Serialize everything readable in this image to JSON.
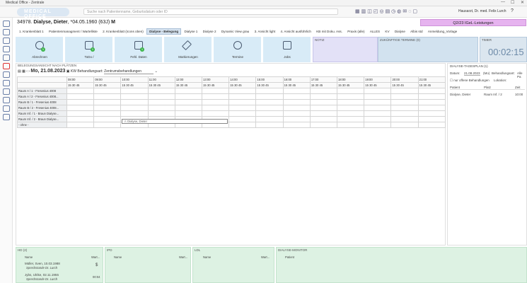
{
  "window": {
    "title": "Medical Office - Zentrale"
  },
  "header": {
    "logo": "MEDICAL OFFICE",
    "search_placeholder": "Suche nach Patientenname, Geburtsdatum oder ID",
    "user": "Hausarzt, Dr. med. Felix Lurch"
  },
  "patient": {
    "id": "34978.",
    "name": "Dialyse, Dieter",
    "dob": "*04.05.1960 (63J)",
    "sex": "M"
  },
  "igel_button": "Q2/23 IGeL-Leistungen",
  "tabs": [
    "1. Krankenblatt 1",
    "Patientenmanagment / Wartelliste",
    "2. Krankenblatt (Icons oben)",
    "Dialyse - Belegung",
    "Dialyse 1",
    "Dialyse 2",
    "Dynamic View grau",
    "3. Ansicht light",
    "4. Ansicht ausführlich",
    "KB mit Doku. Ass.",
    "Praxis (alle)",
    "ALLES",
    "KV",
    "Dialyse",
    "Albis std",
    "Anmeldung_Vorlage"
  ],
  "active_tab": "Dialyse - Belegung",
  "tiles": [
    {
      "label": "Abrechnen",
      "badge": "1"
    },
    {
      "label": "ToDo /",
      "badge": "1"
    },
    {
      "label": "Fehl. Daten",
      "badge": "1"
    },
    {
      "label": "Markierungen",
      "badge": ""
    },
    {
      "label": "Termine",
      "badge": ""
    },
    {
      "label": "Jobs",
      "badge": ""
    }
  ],
  "panels": {
    "notiz": "NOTIZ",
    "zukuenftige": "ZUKÜNFTIGE TERMINE (0)",
    "timer": "TIMER",
    "timer_value": "00:02:15"
  },
  "belegung": {
    "title": "BELEGUNGSANSICHT NACH PLÄTZEN",
    "date": "Mo, 21.08.2023",
    "kw": "KW",
    "behandlungsart_label": "Behandlungsart:",
    "behandlungsart_value": "Zentrumsbehandlungen",
    "hours": [
      "08:00",
      "09:00",
      "10:00",
      "11:00",
      "12:00",
      "13:00",
      "14:00",
      "15:00",
      "16:00",
      "17:00",
      "18:00",
      "19:00",
      "20:00",
      "21:00"
    ],
    "quarters": [
      "15",
      "30",
      "45"
    ],
    "rooms": [
      "Raum A / 1 - Fresenius 4008",
      "Raum A / 2 - Fresenius 4008...",
      "Raum B / 1 - Fresenius 4008",
      "Raum B / 2 - Fresenius 4008...",
      "Raum Inf. / 1 - Braun Dialyse...",
      "Raum Inf. / 2 - Braun Dialyse...",
      "- ohne -"
    ],
    "appointment": "Dialyse, Dieter"
  },
  "dialyse_tagesplan": {
    "title": "DIALYSE-TAGESPLAN (1)",
    "datum_label": "Datum:",
    "datum_value": "21.08.2023",
    "day": "(Mo)",
    "behandlungsart": "Behandlungsart:",
    "behandlungsart_value": "Alle Pa",
    "filter": "nur offene Behandlungen",
    "lokation": "Lokation:",
    "columns": [
      "Patient",
      "Platz",
      "Zeit"
    ],
    "rows": [
      {
        "patient": "Dialyse, Dieter",
        "platz": "Raum Inf. / 2",
        "zeit": "10:00"
      }
    ]
  },
  "bottom": {
    "hd": {
      "title": "HD (2)",
      "col1": "Name",
      "col2": "Wart...",
      "rows": [
        {
          "name": "Müller, Sven, 10.03.1988",
          "sub": "Sprechstunde Dr. Lurch",
          "val": "$"
        },
        {
          "name": "Jybs, Ulrike, 02.11.1955",
          "sub": "Sprechstunde Dr. Lurch",
          "val": "00:04"
        }
      ]
    },
    "ipd": {
      "title": "IPD",
      "col1": "Name",
      "col2": "Wart..."
    },
    "ldl": {
      "title": "LDL",
      "col1": "Name",
      "col2": "Wart..."
    },
    "monitor": {
      "title": "DIALYSE-MONITOR",
      "col1": "Patient"
    }
  }
}
